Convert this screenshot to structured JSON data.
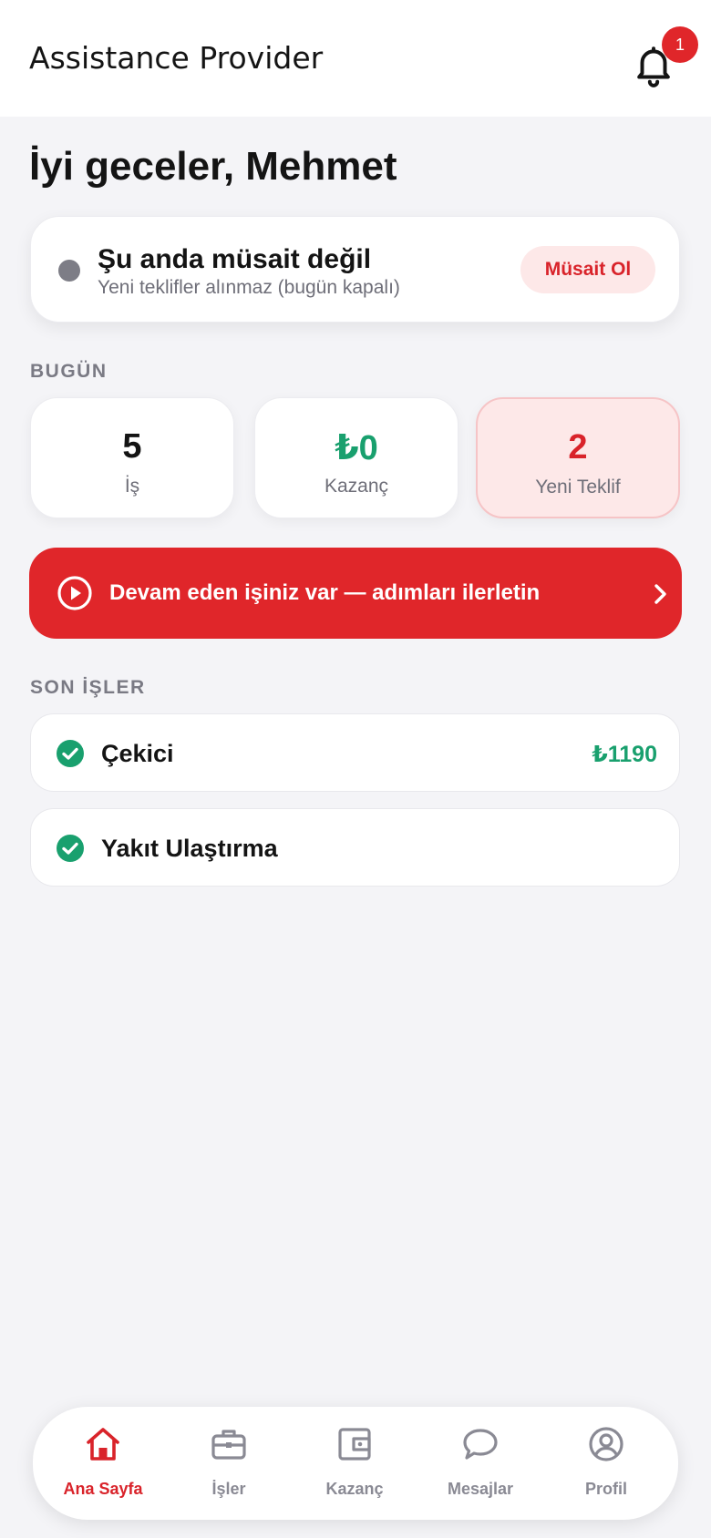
{
  "header": {
    "title": "Assistance Provider",
    "notification_count": "1",
    "bell_icon": "bell-icon"
  },
  "greeting": "İyi geceler, Mehmet",
  "availability": {
    "status_title": "Şu anda müsait değil",
    "status_subtitle": "Yeni teklifler alınmaz (bugün kapalı)",
    "button_label": "Müsait Ol",
    "dot_color": "#7d7d86"
  },
  "today": {
    "section_label": "BUGÜN",
    "stats": [
      {
        "value": "5",
        "label": "İş",
        "color": "#141414"
      },
      {
        "value": "₺0",
        "label": "Kazanç",
        "color": "#19a06e"
      },
      {
        "value": "2",
        "label": "Yeni Teklif",
        "color": "#d9232a"
      }
    ]
  },
  "banner": {
    "text": "Devam eden işiniz var — adımları ilerletin",
    "icon": "play-circle-icon",
    "color": "#e0262a"
  },
  "recent_jobs": {
    "section_label": "SON İŞLER",
    "items": [
      {
        "title": "Çekici",
        "amount": "₺1190",
        "status_icon": "check-circle-icon"
      },
      {
        "title": "Yakıt Ulaştırma",
        "amount": "",
        "status_icon": "check-circle-icon"
      }
    ]
  },
  "bottom_nav": {
    "items": [
      {
        "label": "Ana Sayfa",
        "icon": "home-icon",
        "active": true
      },
      {
        "label": "İşler",
        "icon": "briefcase-icon",
        "active": false
      },
      {
        "label": "Kazanç",
        "icon": "wallet-icon",
        "active": false
      },
      {
        "label": "Mesajlar",
        "icon": "chat-bubble-icon",
        "active": false
      },
      {
        "label": "Profil",
        "icon": "user-circle-icon",
        "active": false
      }
    ],
    "active_color": "#d9232a",
    "inactive_color": "#8a8a94"
  },
  "colors": {
    "accent": "#e0262a",
    "success": "#19a06e",
    "background": "#f4f4f7"
  }
}
